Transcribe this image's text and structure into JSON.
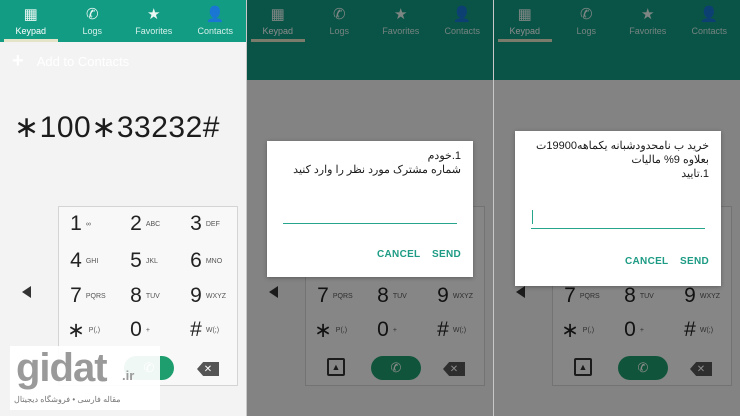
{
  "tabs": [
    {
      "label": "Keypad",
      "icon": "keypad-icon",
      "glyph": "▦"
    },
    {
      "label": "Logs",
      "icon": "logs-icon",
      "glyph": "✆"
    },
    {
      "label": "Favorites",
      "icon": "star-icon",
      "glyph": "★"
    },
    {
      "label": "Contacts",
      "icon": "person-icon",
      "glyph": "👤"
    }
  ],
  "add_to_contacts": {
    "plus": "+",
    "label": "Add to Contacts"
  },
  "dialed_number": "∗100∗33232#",
  "keys": [
    {
      "digit": "1",
      "sub": "∞"
    },
    {
      "digit": "2",
      "sub": "ABC"
    },
    {
      "digit": "3",
      "sub": "DEF"
    },
    {
      "digit": "4",
      "sub": "GHI"
    },
    {
      "digit": "5",
      "sub": "JKL"
    },
    {
      "digit": "6",
      "sub": "MNO"
    },
    {
      "digit": "7",
      "sub": "PQRS"
    },
    {
      "digit": "8",
      "sub": "TUV"
    },
    {
      "digit": "9",
      "sub": "WXYZ"
    },
    {
      "digit": "∗",
      "sub": "P(,)"
    },
    {
      "digit": "0",
      "sub": "+"
    },
    {
      "digit": "#",
      "sub": "W(;)"
    }
  ],
  "dialog1": {
    "line1": "1.خودم",
    "line2": "شماره مشترک مورد نظر را وارد کنید",
    "cancel": "CANCEL",
    "send": "SEND"
  },
  "dialog2": {
    "line1": "خرید ب نامحدودشبانه یکماهه19900ت",
    "line2": "بعلاوه 9% مالیات",
    "line3": "1.تایید",
    "cancel": "CANCEL",
    "send": "SEND"
  },
  "watermark": {
    "brand": "gidat",
    "tld": ".ir",
    "tagline": "مقاله فارسی • فروشگاه دیجیتال"
  },
  "colors": {
    "accent": "#139c84",
    "call": "#1e9e6e",
    "button_text": "#1d9b84"
  }
}
